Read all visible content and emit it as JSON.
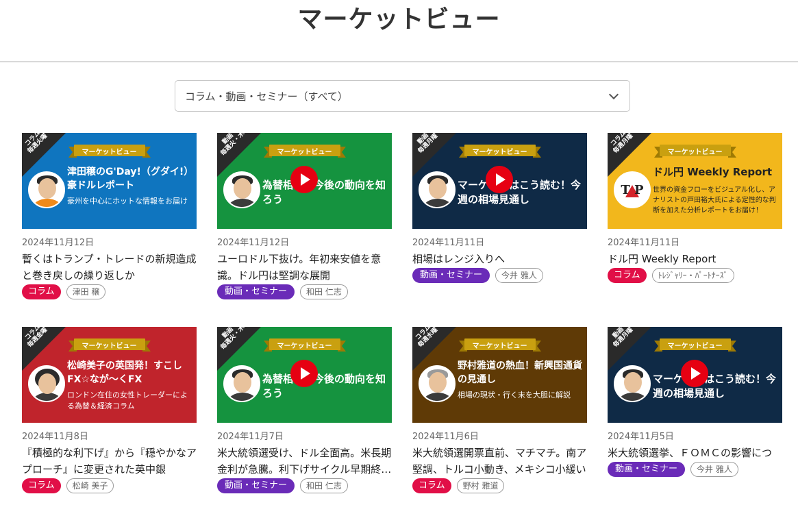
{
  "page": {
    "title": "マーケットビュー"
  },
  "filter": {
    "selected": "コラム・動画・セミナー（すべて）"
  },
  "banner_label": "マーケットビュー",
  "cards": [
    {
      "theme": "blue",
      "kind": "column",
      "corner_type": "コラム",
      "corner_schedule": "毎週火曜",
      "thumb_title": "津田穣のG'Day!（グダイ!）豪ドルレポート",
      "thumb_sub": "豪州を中心にホットな情報をお届け",
      "date": "2024年11月12日",
      "title": "暫くはトランプ・トレードの新規造成と巻き戻しの繰り返しか",
      "category": "コラム",
      "author": "津田 穣"
    },
    {
      "theme": "green",
      "kind": "video",
      "corner_type": "動画",
      "corner_schedule": "毎週火・木",
      "thumb_title": "為替相場の今後の動向を知ろう",
      "thumb_sub": "",
      "date": "2024年11月12日",
      "title": "ユーロドル下抜け。年初来安値を意識。ドル円は堅調な展開",
      "category": "動画・セミナー",
      "author": "和田 仁志"
    },
    {
      "theme": "navy",
      "kind": "video",
      "corner_type": "動画",
      "corner_schedule": "毎週月曜",
      "thumb_title": "マーケットはこう読む！今週の相場見通し",
      "thumb_sub": "",
      "date": "2024年11月11日",
      "title": "相場はレンジ入りへ",
      "category": "動画・セミナー",
      "author": "今井 雅人"
    },
    {
      "theme": "yellow",
      "kind": "column",
      "corner_type": "コラム",
      "corner_schedule": "毎週月曜",
      "thumb_title": "ドル円 Weekly Report",
      "thumb_sub": "世界の資金フローをビジュアル化し、アナリストの戸田裕大氏による定性的な判断を加えた分析レポートをお届け！",
      "date": "2024年11月11日",
      "title": "ドル円 Weekly Report",
      "category": "コラム",
      "author": "ﾄﾚｼﾞｬﾘｰ・ﾊﾟｰﾄﾅｰｽﾞ"
    },
    {
      "theme": "red",
      "kind": "column",
      "corner_type": "コラム",
      "corner_schedule": "毎週金曜",
      "thumb_title": "松崎美子の英国発！すこしFX☆なが〜くFX",
      "thumb_sub": "ロンドン在住の女性トレーダーによる為替＆経済コラム",
      "date": "2024年11月8日",
      "title": "『積極的な利下げ』から『穏やかなアプローチ』に変更された英中銀",
      "category": "コラム",
      "author": "松崎 美子"
    },
    {
      "theme": "green",
      "kind": "video",
      "corner_type": "動画",
      "corner_schedule": "毎週火・木",
      "thumb_title": "為替相場の今後の動向を知ろう",
      "thumb_sub": "",
      "date": "2024年11月7日",
      "title": "米大統領選受け、ドル全面高。米長期金利が急騰。利下げサイクル早期終…",
      "category": "動画・セミナー",
      "author": "和田 仁志"
    },
    {
      "theme": "brown",
      "kind": "column",
      "corner_type": "コラム",
      "corner_schedule": "毎週水曜",
      "thumb_title": "野村雅道の熱血！新興国通貨の見通し",
      "thumb_sub": "相場の現状・行く末を大胆に解説",
      "date": "2024年11月6日",
      "title": "米大統領選開票直前、マチマチ。南ア堅調、トルコ小動き、メキシコ小緩い",
      "category": "コラム",
      "author": "野村 雅道"
    },
    {
      "theme": "navy",
      "kind": "video",
      "corner_type": "動画",
      "corner_schedule": "毎週月曜",
      "thumb_title": "マーケットはこう読む！今週の相場見通し",
      "thumb_sub": "",
      "date": "2024年11月5日",
      "title": "米大統領選挙、ＦＯＭＣの影響について",
      "category": "動画・セミナー",
      "author": "今井 雅人"
    }
  ]
}
